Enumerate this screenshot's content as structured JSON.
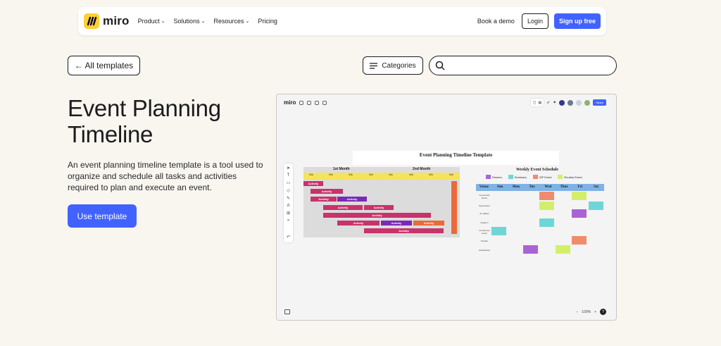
{
  "nav": {
    "logo": "miro",
    "items": [
      "Product",
      "Solutions",
      "Resources",
      "Pricing"
    ],
    "book_demo": "Book a demo",
    "login": "Login",
    "signup": "Sign up free"
  },
  "toolbar": {
    "all_templates": "← All templates",
    "categories": "Categories",
    "search_placeholder": ""
  },
  "template": {
    "title": "Event Planning Timeline",
    "description": "An event planning timeline template is a tool used to organize and schedule all tasks and activities required to plan and execute an event.",
    "use_button": "Use template"
  },
  "preview": {
    "logo": "miro",
    "share": "Share",
    "timeline_title": "Event Planning Timeline Template",
    "months": [
      "1st Month",
      "2nd Month"
    ],
    "week_label": "Wk",
    "bar_label": "Activity",
    "schedule_title": "Weekly Event Schedule",
    "legend": [
      "Dinners",
      "Seminars",
      "VIP Event",
      "Routine Event"
    ],
    "days": [
      "Venue",
      "Sun",
      "Mon",
      "Tue",
      "Wed",
      "Thur",
      "Fri",
      "Sat"
    ],
    "rows": [
      "Community dinner",
      "Symposium",
      "Art gallery",
      "Stadium",
      "Conference center",
      "Theater",
      "Ampitheater"
    ],
    "zoom": "100%",
    "colors": {
      "brand": "#ffd02f",
      "accent": "#4262ff",
      "dinners": "#a964d4",
      "seminars": "#6fd6d6",
      "vip": "#f08c6c",
      "routine": "#d3ef6a"
    }
  }
}
